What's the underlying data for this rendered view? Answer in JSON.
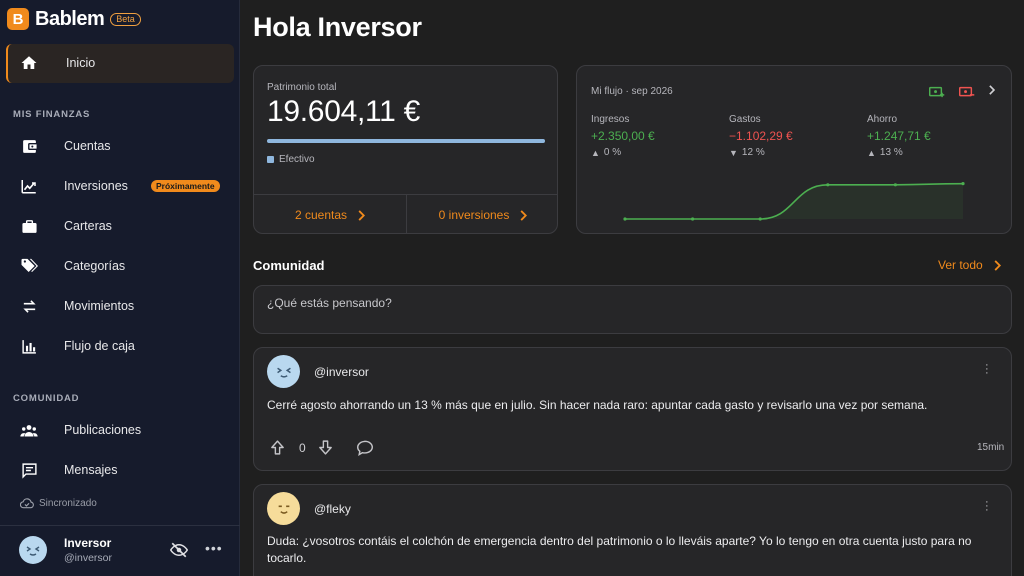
{
  "brand": {
    "name": "Bablem",
    "badge": "Beta",
    "logo_letter": "B"
  },
  "sidebar": {
    "active": {
      "label": "Inicio",
      "icon": "home-icon"
    },
    "sections": [
      {
        "title": "MIS FINANZAS",
        "items": [
          {
            "label": "Cuentas",
            "icon": "wallet-icon"
          },
          {
            "label": "Inversiones",
            "icon": "trending-up-icon",
            "badge": "Próximamente"
          },
          {
            "label": "Carteras",
            "icon": "briefcase-icon"
          },
          {
            "label": "Categorías",
            "icon": "tags-icon"
          },
          {
            "label": "Movimientos",
            "icon": "swap-icon"
          },
          {
            "label": "Flujo de caja",
            "icon": "bar-chart-icon"
          }
        ]
      },
      {
        "title": "COMUNIDAD",
        "items": [
          {
            "label": "Publicaciones",
            "icon": "people-icon"
          },
          {
            "label": "Mensajes",
            "icon": "message-icon"
          }
        ]
      }
    ],
    "sync_status": "Sincronizado",
    "user": {
      "name": "Inversor",
      "handle": "@inversor"
    }
  },
  "main": {
    "title": "Hola Inversor",
    "patrimonio": {
      "label": "Patrimonio total",
      "value": "19.604,11 €",
      "legend": "Efectivo",
      "bar_fraction": 1.0,
      "accounts_link": "2 cuentas",
      "investments_link": "0 inversiones"
    },
    "flow": {
      "title": "Mi flujo · sep 2026",
      "columns": [
        {
          "label": "Ingresos",
          "value": "+2.350,00 €",
          "pct": "0 %",
          "trend": "up",
          "color": "#4caf50"
        },
        {
          "label": "Gastos",
          "value": "−1.102,29 €",
          "pct": "12 %",
          "trend": "down",
          "color": "#ef5350"
        },
        {
          "label": "Ahorro",
          "value": "+1.247,71 €",
          "pct": "13 %",
          "trend": "up",
          "color": "#4caf50"
        }
      ],
      "chart_data": {
        "type": "area",
        "values": [
          0,
          0,
          0,
          0.9,
          0.9,
          0.93
        ]
      }
    },
    "community": {
      "title": "Comunidad",
      "see_all": "Ver todo",
      "compose_placeholder": "¿Qué estás pensando?"
    },
    "posts": [
      {
        "user": "@inversor",
        "avatar_color": "#b9d8ef",
        "text": "Cerré agosto ahorrando un 13 % más que en julio. Sin hacer nada raro: apuntar cada gasto y revisarlo una vez por semana.",
        "votes": "0",
        "time": "15min"
      },
      {
        "user": "@fleky",
        "avatar_color": "#f6dc9a",
        "text": "Duda: ¿vosotros contáis el colchón de emergencia dentro del patrimonio o lo lleváis aparte? Yo lo tengo en otra cuenta justo para no tocarlo."
      }
    ]
  },
  "colors": {
    "accent": "#f08a1c",
    "income": "#4caf50",
    "expense": "#ef5350",
    "patrimonio_bar": "#8fb7de"
  }
}
